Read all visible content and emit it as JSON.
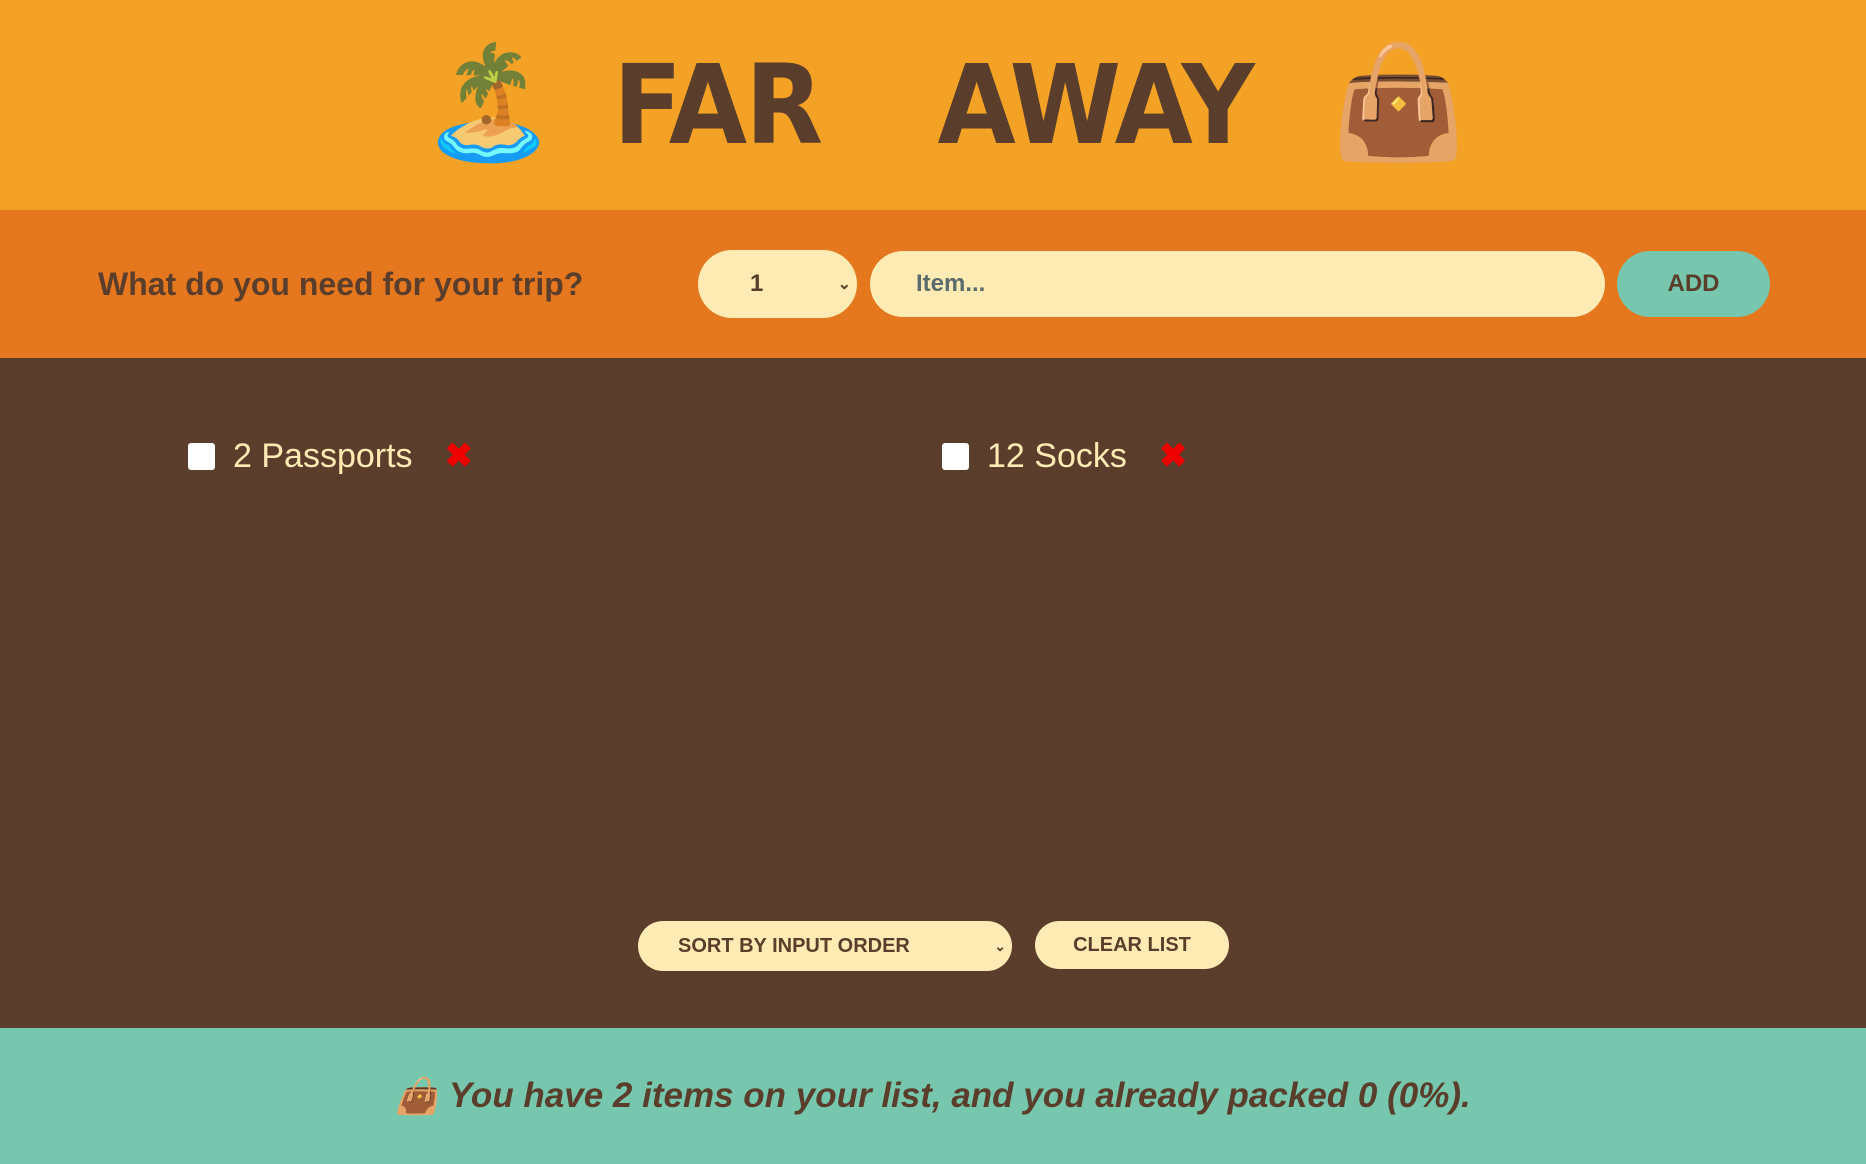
{
  "header": {
    "title": "FAR AWAY",
    "left_emoji": "🏝️",
    "right_emoji": "👜"
  },
  "form": {
    "label": "What do you need for your trip?",
    "quantity": "1",
    "item_placeholder": "Item...",
    "add_label": "ADD"
  },
  "items": [
    {
      "label": "2 Passports",
      "packed": false
    },
    {
      "label": "12 Socks",
      "packed": false
    }
  ],
  "actions": {
    "sort_value": "SORT BY INPUT ORDER",
    "clear_label": "CLEAR LIST"
  },
  "stats": {
    "emoji": "👜",
    "text": "You have 2 items on your list, and you already packed 0 (0%)."
  },
  "colors": {
    "header": "#f4a226",
    "form": "#e5771f",
    "list": "#5a3e2b",
    "stats": "#76c7ad",
    "pill": "#ffebb3"
  }
}
